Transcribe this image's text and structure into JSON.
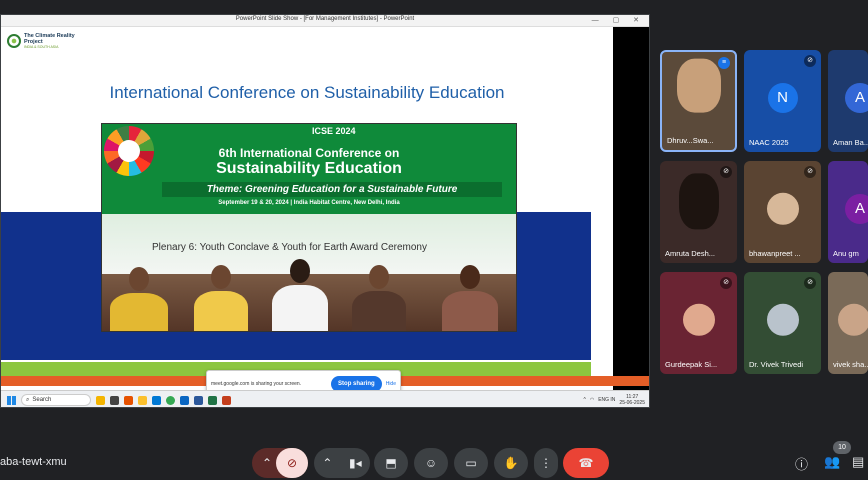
{
  "window": {
    "title": "PowerPoint Slide Show - [For Management Institutes] - PowerPoint",
    "controls": "— ▢ ✕"
  },
  "slide": {
    "logo_text": "The Climate Reality Project",
    "logo_sub": "INDIA & SOUTH ASIA",
    "title": "International Conference on Sustainability Education",
    "photo": {
      "icse": "ICSE 2024",
      "line1": "6th International Conference on",
      "line2": "Sustainability Education",
      "theme": "Theme: Greening Education for a Sustainable Future",
      "date": "September 19 & 20, 2024 | India Habitat Centre, New Delhi, India",
      "banner": "Plenary 6: Youth Conclave & Youth for Earth Award Ceremony"
    }
  },
  "sharing_bar": {
    "info": "meet.google.com is sharing your screen.",
    "stop_label": "Stop sharing",
    "hide_label": "Hide"
  },
  "taskbar": {
    "search_label": "Search",
    "lang": "ENG IN",
    "time": "11:27",
    "date": "25-06-2025"
  },
  "participants": [
    {
      "name": "Dhruv...Swa...",
      "letter": "",
      "bg": "#5b4a3a",
      "mic": "speaking"
    },
    {
      "name": "NAAC 2025",
      "letter": "N",
      "bg": "#174ea6",
      "avatar_bg": "#1a73e8",
      "mic": "muted"
    },
    {
      "name": "Aman Ba...",
      "letter": "A",
      "bg": "#1e3a6e",
      "avatar_bg": "#3367d6",
      "mic": "muted"
    },
    {
      "name": "Amruta Desh...",
      "letter": "",
      "bg": "#3b2a28",
      "mic": "muted"
    },
    {
      "name": "bhawanpreet ...",
      "letter": "",
      "bg": "#5a4432",
      "mic": "muted"
    },
    {
      "name": "Anu gm",
      "letter": "A",
      "bg": "#4a2a8a",
      "avatar_bg": "#7b1fa2",
      "mic": "muted"
    },
    {
      "name": "Gurdeepak Si...",
      "letter": "",
      "bg": "#6a2433",
      "mic": "muted"
    },
    {
      "name": "Dr. Vivek Trivedi",
      "letter": "",
      "bg": "#334d34",
      "mic": "muted"
    },
    {
      "name": "vivek sha...",
      "letter": "",
      "bg": "#7a6a58",
      "mic": "muted"
    }
  ],
  "bottom": {
    "meeting_code": "aba-tewt-xmu",
    "people_count": "10"
  },
  "colors": {
    "meet_bg": "#202124",
    "end_call": "#ea4335",
    "accent": "#1a73e8"
  }
}
